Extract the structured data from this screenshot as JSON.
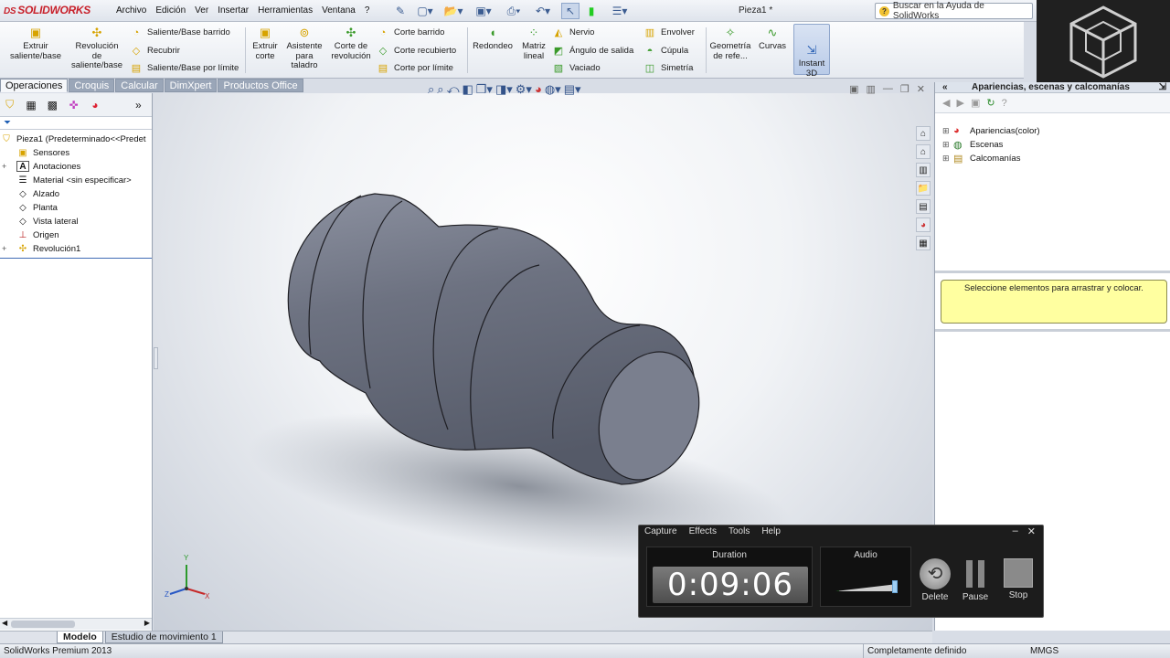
{
  "app": {
    "name": "SOLIDWORKS",
    "doc_title": "Pieza1 *"
  },
  "menu": [
    "Archivo",
    "Edición",
    "Ver",
    "Insertar",
    "Herramientas",
    "Ventana",
    "?"
  ],
  "help_search_placeholder": "Buscar en la Ayuda de SolidWorks",
  "ribbon": {
    "extrude_boss": "Extruir saliente/base",
    "revolve_boss": "Revolución de saliente/base",
    "swept_boss": "Saliente/Base barrido",
    "loft": "Recubrir",
    "boundary_boss": "Saliente/Base por límite",
    "extrude_cut": "Extruir corte",
    "hole_wizard": "Asistente para taladro",
    "revolve_cut": "Corte de revolución",
    "swept_cut": "Corte barrido",
    "lofted_cut": "Corte recubierto",
    "boundary_cut": "Corte por límite",
    "fillet": "Redondeo",
    "linear_pattern": "Matriz lineal",
    "rib": "Nervio",
    "draft": "Ángulo de salida",
    "shell": "Vaciado",
    "wrap": "Envolver",
    "dome": "Cúpula",
    "mirror": "Simetría",
    "ref_geometry": "Geometría de refe...",
    "curves": "Curvas",
    "instant3d": "Instant 3D"
  },
  "command_tabs": [
    "Operaciones",
    "Croquis",
    "Calcular",
    "DimXpert",
    "Productos Office"
  ],
  "feature_tree": [
    {
      "label": "Pieza1  (Predeterminado<<Predet",
      "icon": "part-icon",
      "expander": ""
    },
    {
      "label": "Sensores",
      "icon": "sensor-icon",
      "expander": ""
    },
    {
      "label": "Anotaciones",
      "icon": "annotation-icon",
      "expander": "+"
    },
    {
      "label": "Material <sin especificar>",
      "icon": "material-icon",
      "expander": ""
    },
    {
      "label": "Alzado",
      "icon": "plane-icon",
      "expander": ""
    },
    {
      "label": "Planta",
      "icon": "plane-icon",
      "expander": ""
    },
    {
      "label": "Vista lateral",
      "icon": "plane-icon",
      "expander": ""
    },
    {
      "label": "Origen",
      "icon": "origin-icon",
      "expander": ""
    },
    {
      "label": "Revolución1",
      "icon": "revolve-icon",
      "expander": "+"
    }
  ],
  "task_pane": {
    "title": "Apariencias, escenas y calcomanías",
    "items": [
      "Apariencias(color)",
      "Escenas",
      "Calcomanías"
    ],
    "hint": "Seleccione elementos para arrastrar y colocar."
  },
  "bottom_tabs": [
    "Modelo",
    "Estudio de movimiento 1"
  ],
  "status": {
    "product": "SolidWorks Premium 2013",
    "state": "Completamente definido",
    "units": "MMGS"
  },
  "axis_labels": {
    "x": "X",
    "y": "Y",
    "z": "Z"
  },
  "recorder": {
    "menu": [
      "Capture",
      "Effects",
      "Tools",
      "Help"
    ],
    "duration_label": "Duration",
    "duration": "0:09:06",
    "audio_label": "Audio",
    "audio_level": 0.06,
    "buttons": [
      "Delete",
      "Pause",
      "Stop"
    ]
  },
  "colors": {
    "model": "#6c7180",
    "brand_red": "#c8202a",
    "hint_bg": "#ffffa0"
  }
}
